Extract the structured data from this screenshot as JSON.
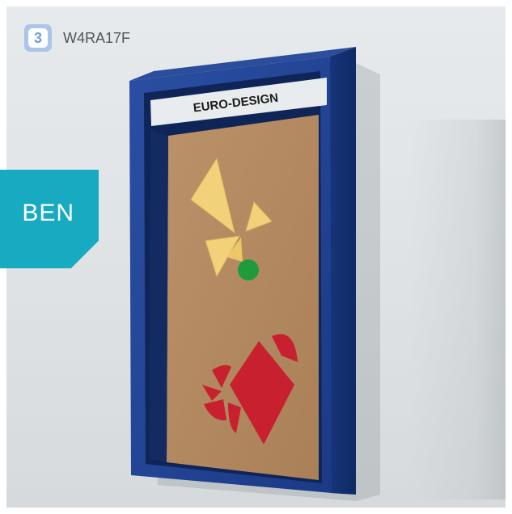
{
  "product": {
    "badge_glyph": "3",
    "code": "W4RA17F"
  },
  "side_tab": {
    "text": "BEN",
    "color": "#17aac1"
  },
  "cabinet": {
    "header_text": "EURO-DESIGN",
    "frame_color": "#1d3f8f",
    "board_color": "#b38861"
  },
  "board_shapes": {
    "yellow": "#f1d27a",
    "green": "#1f9a3c",
    "red": "#c8202e"
  }
}
